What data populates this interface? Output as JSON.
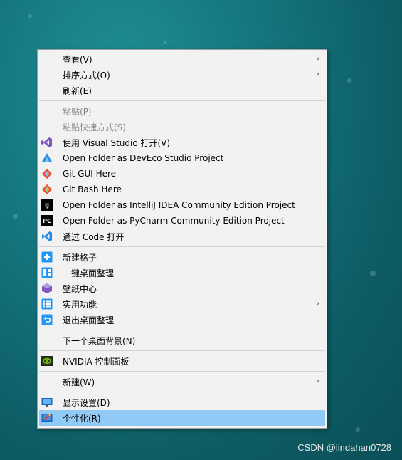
{
  "menu": {
    "items": [
      {
        "label": "查看(V)",
        "icon": "",
        "submenu": true
      },
      {
        "label": "排序方式(O)",
        "icon": "",
        "submenu": true
      },
      {
        "label": "刷新(E)",
        "icon": ""
      },
      {
        "label": "粘贴(P)",
        "icon": "",
        "disabled": true
      },
      {
        "label": "粘贴快捷方式(S)",
        "icon": "",
        "disabled": true
      },
      {
        "label": "使用 Visual Studio 打开(V)",
        "icon": "visual-studio-icon"
      },
      {
        "label": "Open Folder as DevEco Studio Project",
        "icon": "deveco-studio-icon"
      },
      {
        "label": "Git GUI Here",
        "icon": "git-gui-icon"
      },
      {
        "label": "Git Bash Here",
        "icon": "git-bash-icon"
      },
      {
        "label": "Open Folder as IntelliJ IDEA Community Edition Project",
        "icon": "intellij-idea-icon"
      },
      {
        "label": "Open Folder as PyCharm Community Edition Project",
        "icon": "pycharm-icon"
      },
      {
        "label": "通过 Code 打开",
        "icon": "vscode-icon"
      },
      {
        "label": "新建格子",
        "icon": "new-grid-icon"
      },
      {
        "label": "一键桌面整理",
        "icon": "desktop-organize-icon"
      },
      {
        "label": "壁纸中心",
        "icon": "wallpaper-center-icon"
      },
      {
        "label": "实用功能",
        "icon": "utilities-icon",
        "submenu": true
      },
      {
        "label": "退出桌面整理",
        "icon": "exit-organize-icon"
      },
      {
        "label": "下一个桌面背景(N)",
        "icon": ""
      },
      {
        "label": "NVIDIA 控制面板",
        "icon": "nvidia-icon"
      },
      {
        "label": "新建(W)",
        "icon": "",
        "submenu": true
      },
      {
        "label": "显示设置(D)",
        "icon": "display-settings-icon"
      },
      {
        "label": "个性化(R)",
        "icon": "personalize-icon",
        "highlighted": true
      }
    ],
    "submenu_glyph": "›",
    "icon_text": {
      "intellij": "IJ",
      "pycharm": "PC"
    }
  },
  "watermark": "CSDN @lindahan0728",
  "colors": {
    "menu_bg": "#f2f2f2",
    "highlight": "#91c9f7",
    "disabled_text": "#8a8a8a"
  }
}
